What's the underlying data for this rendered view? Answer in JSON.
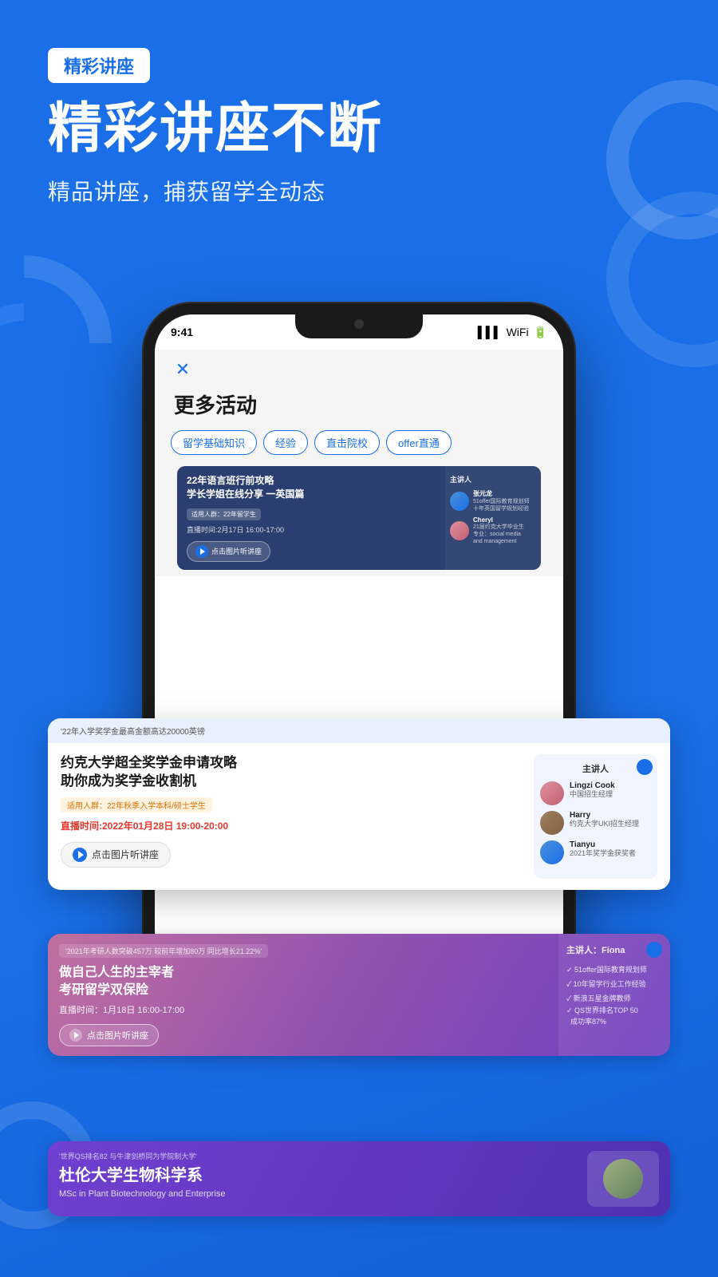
{
  "page": {
    "background_color": "#1a6fe8",
    "tag": "精彩讲座",
    "main_title": "精彩讲座不断",
    "sub_title": "精品讲座，捕获留学全动态"
  },
  "phone": {
    "screen_title": "更多活动",
    "close_icon": "×",
    "filter_tabs": [
      "留学基础知识",
      "经验",
      "直击院校",
      "offer直通"
    ],
    "cards": [
      {
        "id": "card1",
        "top_label": "",
        "title": "22年语言班行前攻略\n学长学姐在线分享 一英国篇",
        "audience_tag": "适用人群：22年留学生",
        "time": "直播时间:2月17日 16:00-17:00",
        "listen_btn": "点击图片听讲座",
        "speakers": [
          {
            "name": "张元龙",
            "role": "51offer国际教育规划师\n十年英国留学规划经验"
          },
          {
            "name": "Cheryl",
            "role": "21届约克大学毕业生\n专业：social media\nand management"
          }
        ]
      },
      {
        "id": "card2_featured",
        "top_label": "'22年入学奖学金最高金额高达20000英镑",
        "title": "约克大学超全奖学金申请攻略\n助你成为奖学金收割机",
        "audience_tag": "适用人群：22年秋季入学本科/硕士学生",
        "time": "直播时间:2022年01月28日 19:00-20:00",
        "listen_btn": "点击图片听讲座",
        "speakers": [
          {
            "name": "Lingzi Cook",
            "role": "中国招生经理"
          },
          {
            "name": "Harry",
            "role": "约克大学UKI招生经理"
          },
          {
            "name": "Tianyu",
            "role": "2021年奖学金获奖者"
          }
        ]
      },
      {
        "id": "card3",
        "top_label": "'2021年考研人数突破457万 较前年增加80万 同比增长21.22%'",
        "title": "做自己人生的主宰者\n考研留学双保险",
        "audience_tag": "",
        "time": "直播时间：1月18日 16:00-17:00",
        "listen_btn": "点击图片听讲座",
        "host": "主讲人：Fiona",
        "speaker_checks": [
          "51offer国际教育规划师",
          "10年留学行业工作经验",
          "新浪五星金牌教师",
          "QS世界排名TOP 50\n成功率87%"
        ]
      },
      {
        "id": "card4",
        "top_label": "'世界QS排名82 与牛津剑桥同为学院制大学'",
        "title": "杜伦大学生物科学系",
        "subtitle": "MSc in Plant Biotechnology and Enterprise"
      }
    ]
  }
}
